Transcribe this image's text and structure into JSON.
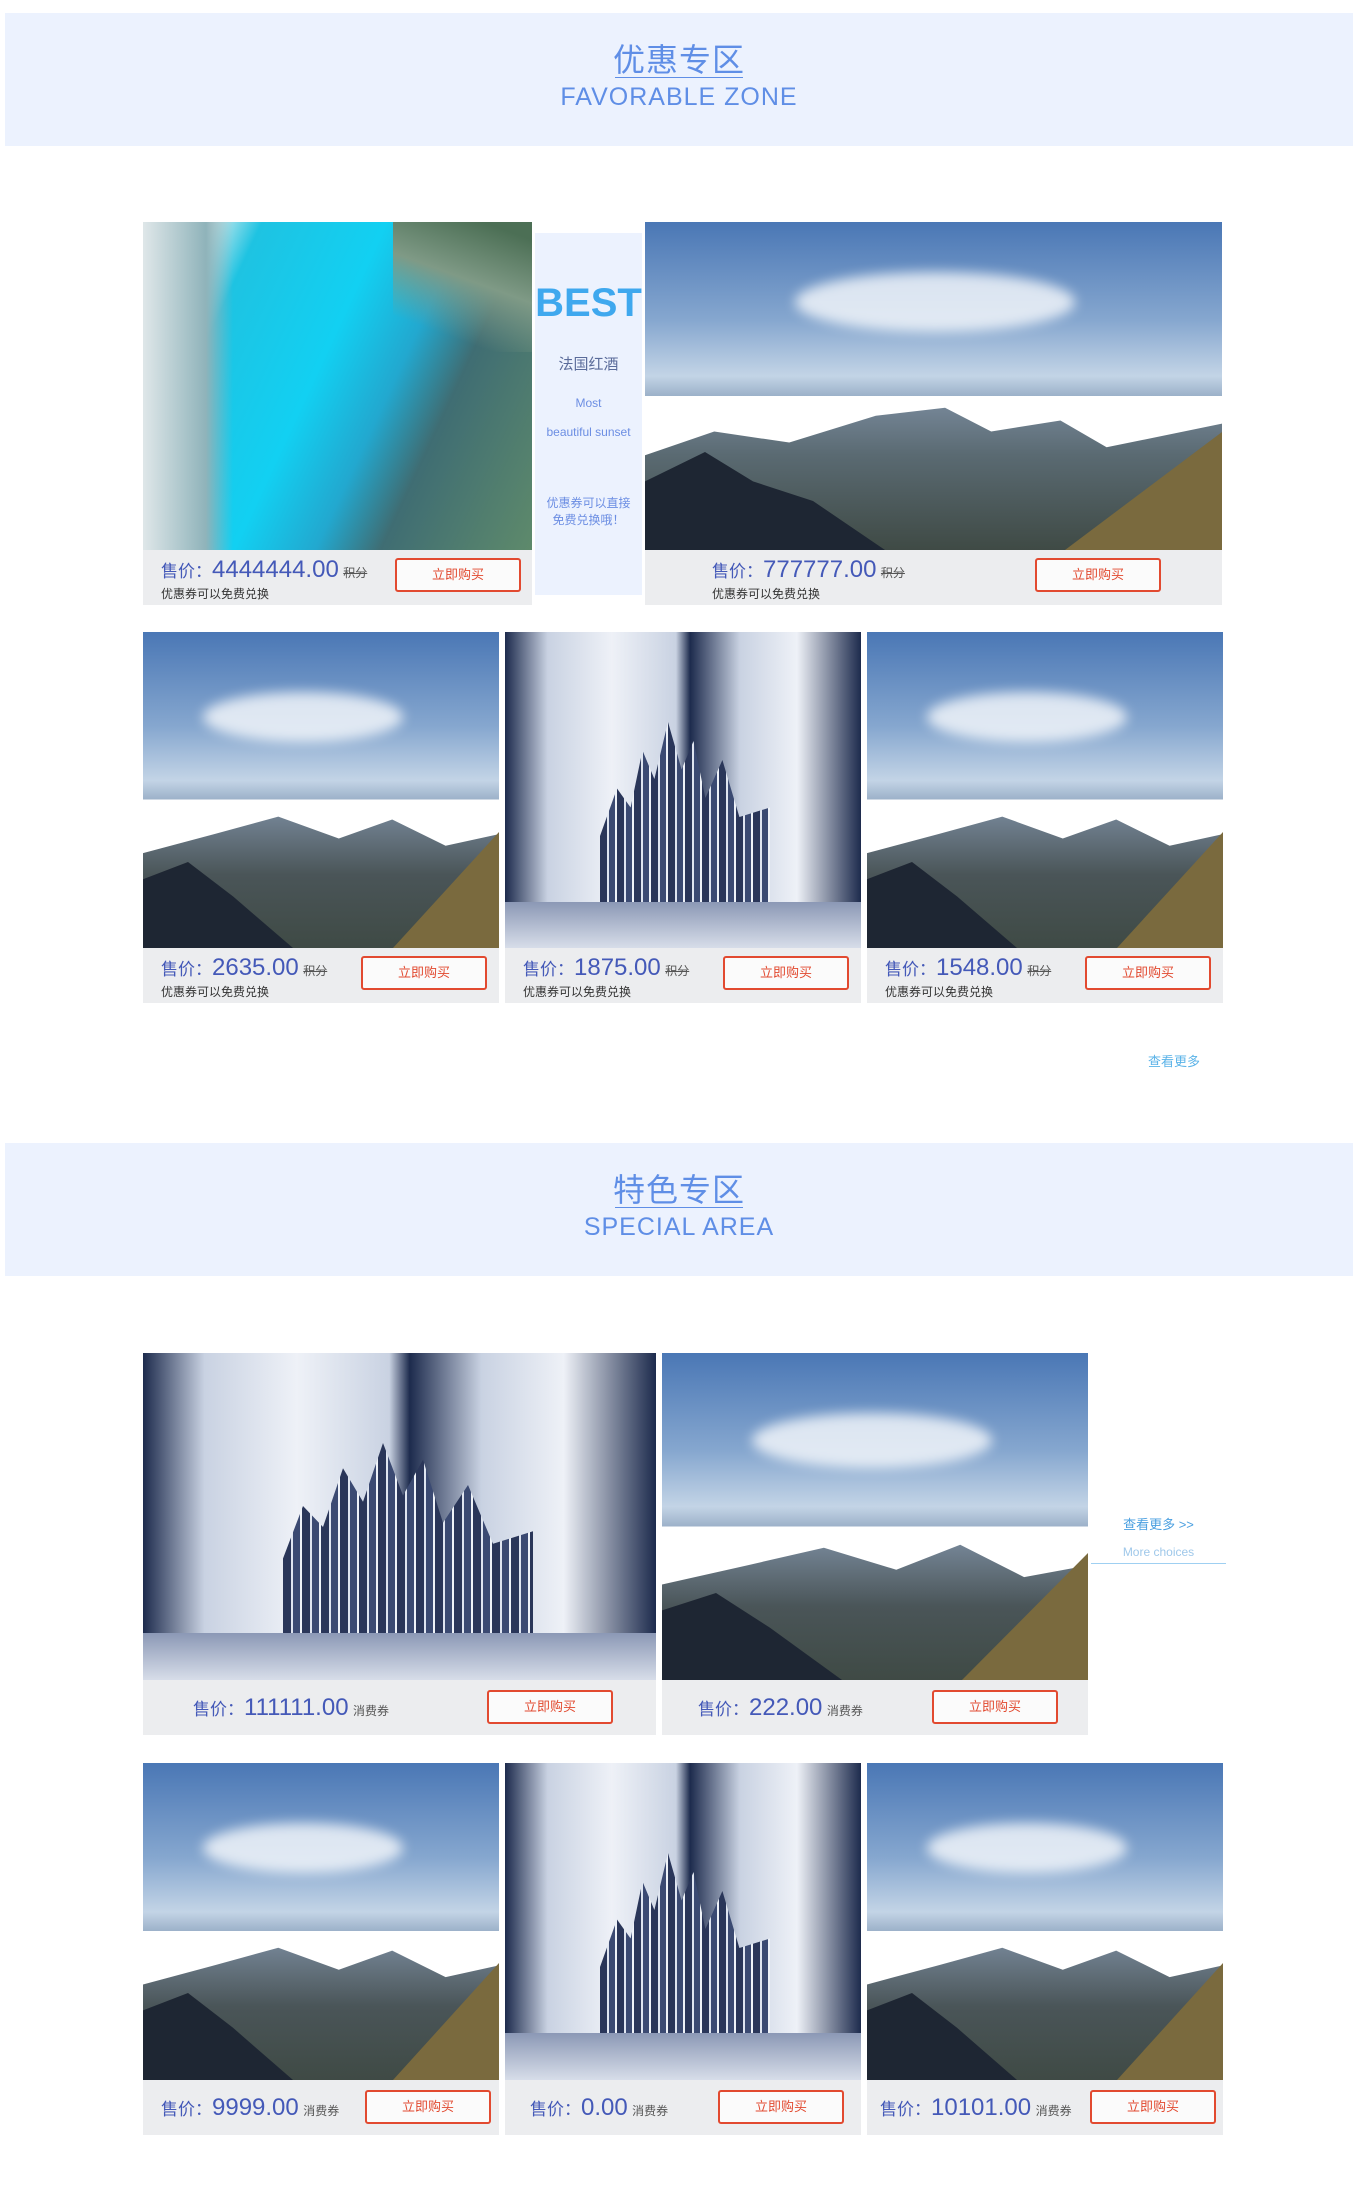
{
  "favorable": {
    "title_zh": "优惠专区",
    "title_en": "FAVORABLE ZONE",
    "best": {
      "heading": "BEST",
      "name": "法国红酒",
      "sub1": "Most",
      "sub2": "beautiful sunset",
      "desc": "优惠券可以直接免费兑换哦！"
    },
    "price_label": "售价：",
    "unit": "积分",
    "note": "优惠券可以免费兑换",
    "buy_label": "立即购买",
    "products": [
      {
        "price": "4444444.00",
        "image": "beach"
      },
      {
        "price": "777777.00",
        "image": "mountain"
      },
      {
        "price": "2635.00",
        "image": "mountain"
      },
      {
        "price": "1875.00",
        "image": "city"
      },
      {
        "price": "1548.00",
        "image": "mountain"
      }
    ],
    "more_label": "查看更多"
  },
  "special": {
    "title_zh": "特色专区",
    "title_en": "SPECIAL AREA",
    "price_label": "售价：",
    "unit": "消费券",
    "buy_label": "立即购买",
    "more_label": "查看更多 >>",
    "more_sub": "More choices",
    "products": [
      {
        "price": "111111.00",
        "image": "city"
      },
      {
        "price": "222.00",
        "image": "mountain"
      },
      {
        "price": "9999.00",
        "image": "mountain"
      },
      {
        "price": "0.00",
        "image": "city"
      },
      {
        "price": "10101.00",
        "image": "mountain"
      }
    ]
  },
  "colors": {
    "accent": "#5f8ee6",
    "band_bg": "#ecf2fe",
    "price": "#4459b8",
    "buy_border": "#e24a30",
    "link": "#5bb3e8"
  }
}
